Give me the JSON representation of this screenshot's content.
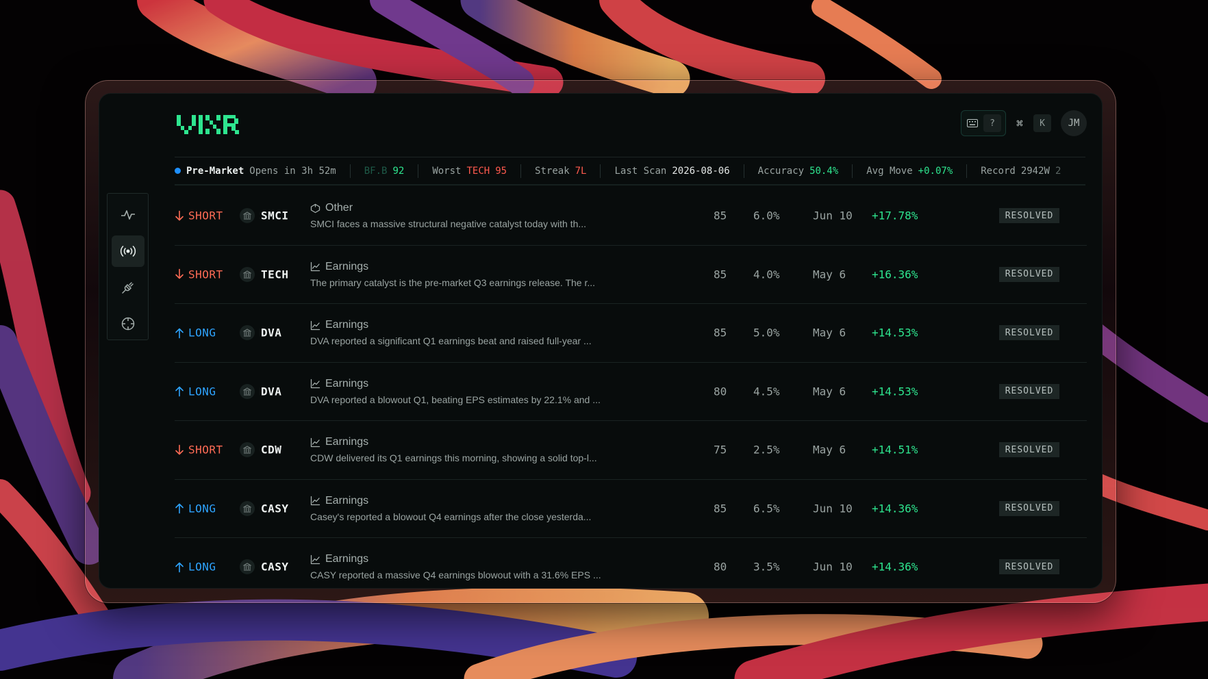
{
  "app": {
    "name": "VIXR"
  },
  "header": {
    "kbd_help": "?",
    "cmd_symbol": "⌘",
    "cmd_key": "K",
    "avatar_initials": "JM"
  },
  "ticker": {
    "market_status": "Pre-Market",
    "opens_in": "Opens in 3h 52m",
    "first_item_label": "BF.B",
    "first_item_value": "92",
    "worst_label": "Worst",
    "worst_symbol": "TECH",
    "worst_value": "95",
    "streak_label": "Streak",
    "streak_value": "7L",
    "last_scan_label": "Last Scan",
    "last_scan_value": "2026-08-06",
    "accuracy_label": "Accuracy",
    "accuracy_value": "50.4%",
    "avg_move_label": "Avg Move",
    "avg_move_value": "+0.07%",
    "record_label": "Record",
    "record_value": "2942W",
    "record_tail": "2"
  },
  "sidebar": {
    "items": [
      {
        "name": "activity",
        "icon": "pulse-icon",
        "active": false
      },
      {
        "name": "signals",
        "icon": "broadcast-icon",
        "active": true
      },
      {
        "name": "integrations",
        "icon": "plug-icon",
        "active": false
      },
      {
        "name": "targets",
        "icon": "crosshair-icon",
        "active": false
      }
    ]
  },
  "rows": [
    {
      "direction": "SHORT",
      "symbol": "SMCI",
      "category": "Other",
      "category_icon": "tag-icon",
      "description": "SMCI faces a massive structural negative catalyst today with th...",
      "score": "85",
      "size": "6.0%",
      "date": "Jun 10",
      "move": "+17.78%",
      "status": "RESOLVED"
    },
    {
      "direction": "SHORT",
      "symbol": "TECH",
      "category": "Earnings",
      "category_icon": "chart-icon",
      "description": "The primary catalyst is the pre-market Q3 earnings release. The r...",
      "score": "85",
      "size": "4.0%",
      "date": "May 6",
      "move": "+16.36%",
      "status": "RESOLVED"
    },
    {
      "direction": "LONG",
      "symbol": "DVA",
      "category": "Earnings",
      "category_icon": "chart-icon",
      "description": "DVA reported a significant Q1 earnings beat and raised full-year ...",
      "score": "85",
      "size": "5.0%",
      "date": "May 6",
      "move": "+14.53%",
      "status": "RESOLVED"
    },
    {
      "direction": "LONG",
      "symbol": "DVA",
      "category": "Earnings",
      "category_icon": "chart-icon",
      "description": "DVA reported a blowout Q1, beating EPS estimates by 22.1% and ...",
      "score": "80",
      "size": "4.5%",
      "date": "May 6",
      "move": "+14.53%",
      "status": "RESOLVED"
    },
    {
      "direction": "SHORT",
      "symbol": "CDW",
      "category": "Earnings",
      "category_icon": "chart-icon",
      "description": "CDW delivered its Q1 earnings this morning, showing a solid top-l...",
      "score": "75",
      "size": "2.5%",
      "date": "May 6",
      "move": "+14.51%",
      "status": "RESOLVED"
    },
    {
      "direction": "LONG",
      "symbol": "CASY",
      "category": "Earnings",
      "category_icon": "chart-icon",
      "description": "Casey's reported a blowout Q4 earnings after the close yesterda...",
      "score": "85",
      "size": "6.5%",
      "date": "Jun 10",
      "move": "+14.36%",
      "status": "RESOLVED"
    },
    {
      "direction": "LONG",
      "symbol": "CASY",
      "category": "Earnings",
      "category_icon": "chart-icon",
      "description": "CASY reported a massive Q4 earnings blowout with a 31.6% EPS ...",
      "score": "80",
      "size": "3.5%",
      "date": "Jun 10",
      "move": "+14.36%",
      "status": "RESOLVED"
    }
  ]
}
